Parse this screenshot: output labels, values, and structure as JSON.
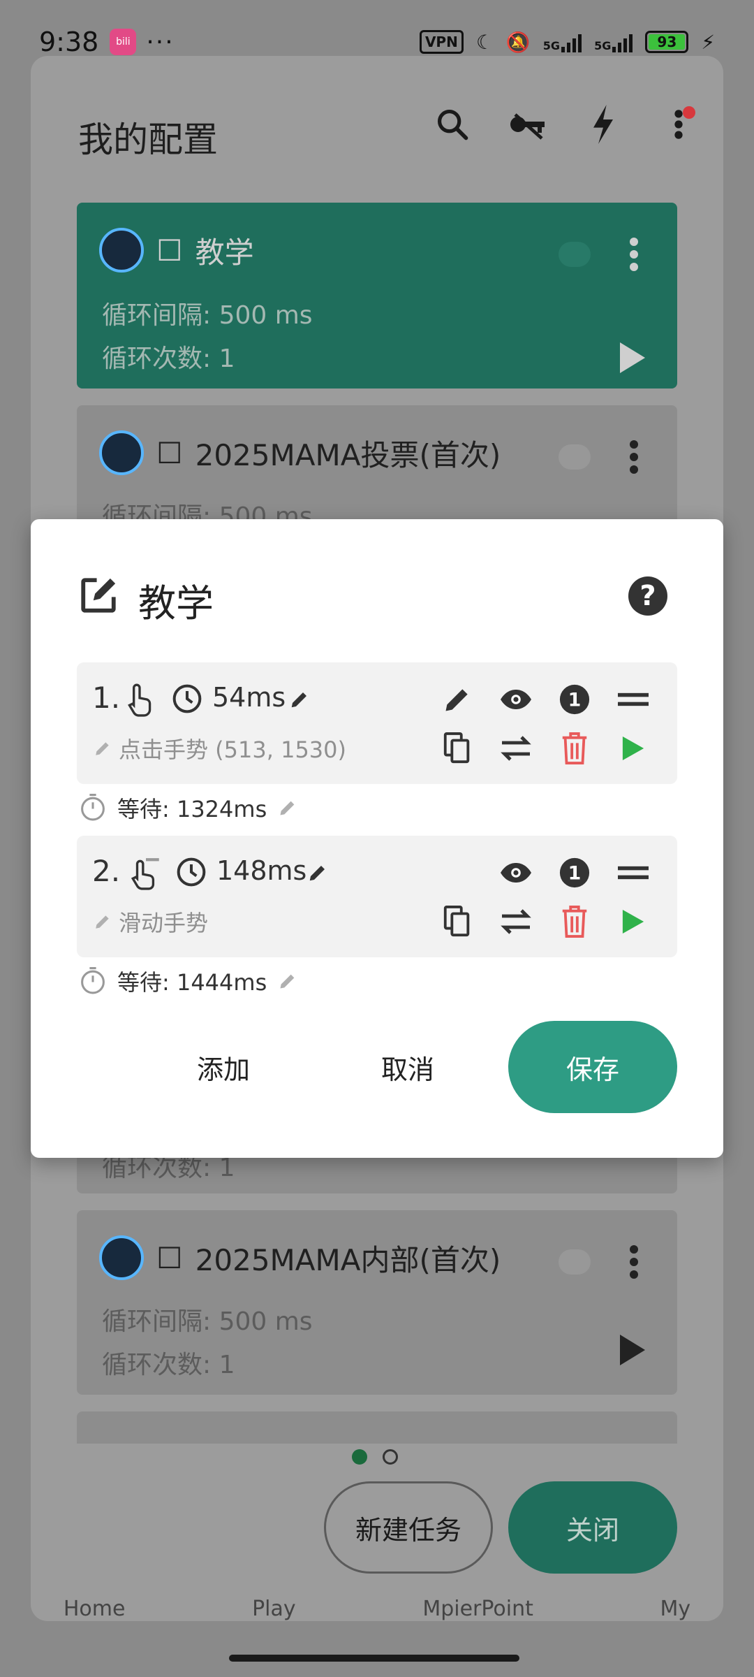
{
  "status_bar": {
    "time": "9:38",
    "more": "···",
    "vpn": "VPN",
    "network1": "5G",
    "network2": "5G",
    "battery": "93"
  },
  "page": {
    "title": "我的配置",
    "icons": [
      "search-icon",
      "key-icon",
      "bolt-icon",
      "more-vert-icon"
    ]
  },
  "cards": [
    {
      "name": "教学",
      "interval": "循环间隔: 500 ms",
      "count": "循环次数: 1"
    },
    {
      "name": "2025MAMA投票(首次)",
      "interval": "循环间隔: 500 ms",
      "count": ""
    },
    {
      "name": "",
      "interval": "",
      "count": "循环次数: 1"
    },
    {
      "name": "2025MAMA内部(首次)",
      "interval": "循环间隔: 500 ms",
      "count": "循环次数: 1"
    }
  ],
  "dialog": {
    "title": "教学",
    "actions": [
      {
        "index": "1.",
        "duration": "54ms",
        "desc": "点击手势 (513, 1530)",
        "wait": "等待: 1324ms"
      },
      {
        "index": "2.",
        "duration": "148ms",
        "desc": "滑动手势",
        "wait": "等待: 1444ms"
      }
    ],
    "buttons": {
      "add": "添加",
      "cancel": "取消",
      "save": "保存"
    },
    "colors": {
      "delete": "#e85a5a",
      "play": "#2fb24a",
      "save": "#2e9c84"
    }
  },
  "footer": {
    "new_task": "新建任务",
    "close": "关闭",
    "nav": [
      "Home",
      "Play",
      "MpierPoint",
      "My"
    ]
  }
}
